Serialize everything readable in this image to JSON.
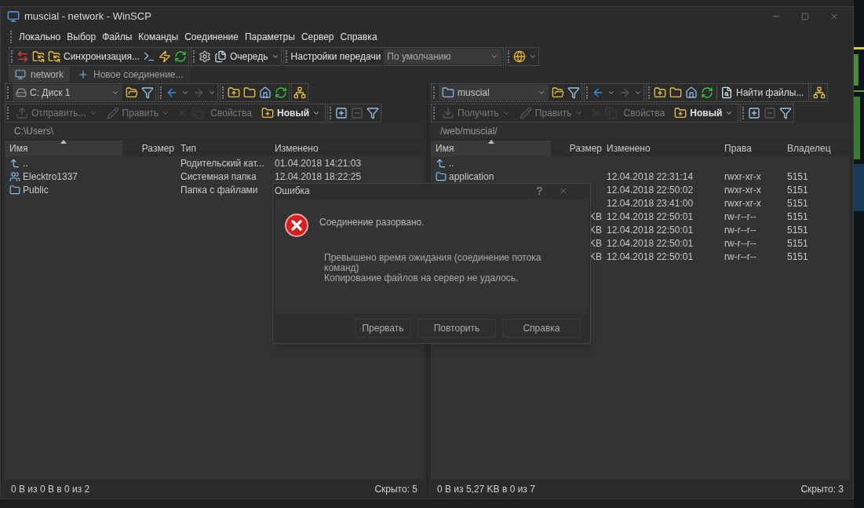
{
  "window": {
    "title": "muscial - network - WinSCP"
  },
  "menu": [
    "Локально",
    "Выбор",
    "Файлы",
    "Команды",
    "Соединение",
    "Параметры",
    "Сервер",
    "Справка"
  ],
  "toolbar": {
    "sync_label": "Синхронизация...",
    "queue_label": "Очередь",
    "transfer_label": "Настройки передачи",
    "transfer_value": "По умолчанию"
  },
  "tabs": [
    {
      "label": "network",
      "selected": true
    },
    {
      "label": "Новое соединение...",
      "selected": false
    }
  ],
  "panels": [
    {
      "kind": "local",
      "location": "C: Диск 1",
      "path": "C:\\Users\\",
      "actions": [
        {
          "label": "Отправить...",
          "disabled": true
        },
        {
          "label": "Править",
          "disabled": true
        },
        {
          "label": "Свойства",
          "disabled": true
        },
        {
          "label": "Новый",
          "disabled": false
        }
      ],
      "columns": [
        {
          "label": "Имя",
          "sorted": true
        },
        {
          "label": "Размер",
          "sorted": false
        },
        {
          "label": "Тип",
          "sorted": false
        },
        {
          "label": "Изменено",
          "sorted": false
        }
      ],
      "rows": [
        {
          "kind": "parent",
          "name": "..",
          "type": "Родительский кат...",
          "modified": "01.04.2018  14:21:03"
        },
        {
          "kind": "users",
          "name": "Elecktro1337",
          "type": "Системная папка",
          "modified": "12.04.2018  18:22:25"
        },
        {
          "kind": "folder",
          "name": "Public",
          "type": "Папка с файлами"
        }
      ],
      "status": "0 B из 0 B в 0 из 2",
      "hidden": "Скрыто: 5"
    },
    {
      "kind": "remote",
      "location": "muscial",
      "find_label": "Найти файлы...",
      "path": "/web/muscial/",
      "actions": [
        {
          "label": "Получить",
          "disabled": true
        },
        {
          "label": "Править",
          "disabled": true
        },
        {
          "label": "Свойства",
          "disabled": true
        },
        {
          "label": "Новый",
          "disabled": false
        }
      ],
      "columns": [
        {
          "label": "Имя",
          "sorted": true
        },
        {
          "label": "Размер",
          "sorted": false
        },
        {
          "label": "Изменено",
          "sorted": false
        },
        {
          "label": "Права",
          "sorted": false
        },
        {
          "label": "Владелец",
          "sorted": false
        }
      ],
      "rows": [
        {
          "kind": "parent",
          "name": ".."
        },
        {
          "kind": "folder",
          "name": "application",
          "modified": "12.04.2018 22:31:14",
          "rights": "rwxr-xr-x",
          "owner": "5151"
        },
        {
          "modified": "12.04.2018 22:50:02",
          "rights": "rwxr-xr-x",
          "owner": "5151"
        },
        {
          "modified": "12.04.2018 23:41:00",
          "rights": "rwxr-xr-x",
          "owner": "5151"
        },
        {
          "size": "KB",
          "modified": "12.04.2018 22:50:01",
          "rights": "rw-r--r--",
          "owner": "5151"
        },
        {
          "size": "KB",
          "modified": "12.04.2018 22:50:01",
          "rights": "rw-r--r--",
          "owner": "5151"
        },
        {
          "size": "KB",
          "modified": "12.04.2018 22:50:01",
          "rights": "rw-r--r--",
          "owner": "5151"
        },
        {
          "size": "KB",
          "modified": "12.04.2018 22:50:01",
          "rights": "rw-r--r--",
          "owner": "5151"
        }
      ],
      "status": "0 B из 5,27 KB в 0 из 7",
      "hidden": "Скрыто: 3"
    }
  ],
  "dialog": {
    "title": "Ошибка",
    "help": "?",
    "message": "Соединение разорвано.",
    "details": [
      "Превышено время ожидания (соединение потока команд)",
      "Копирование файлов на сервер не удалось."
    ],
    "buttons": [
      "Прервать",
      "Повторить",
      "Справка"
    ]
  }
}
